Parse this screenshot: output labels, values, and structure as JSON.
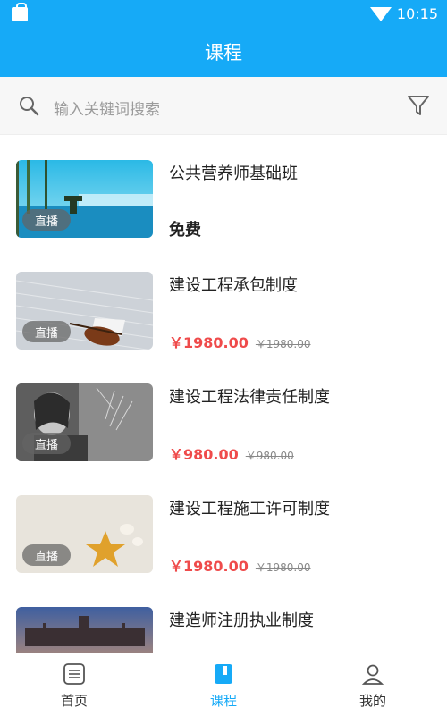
{
  "status_bar": {
    "time": "10:15"
  },
  "header": {
    "title": "课程"
  },
  "search": {
    "placeholder": "输入关键词搜索"
  },
  "courses": [
    {
      "title": "公共营养师基础班",
      "badge": "直播",
      "price": "免费"
    },
    {
      "title": "建设工程承包制度",
      "badge": "直播",
      "price": "￥1980.00",
      "original_price": "￥1980.00"
    },
    {
      "title": "建设工程法律责任制度",
      "badge": "直播",
      "price": "￥980.00",
      "original_price": "￥980.00"
    },
    {
      "title": "建设工程施工许可制度",
      "badge": "直播",
      "price": "￥1980.00",
      "original_price": "￥1980.00"
    },
    {
      "title": "建造师注册执业制度"
    }
  ],
  "bottom_nav": {
    "items": [
      {
        "label": "首页"
      },
      {
        "label": "课程"
      },
      {
        "label": "我的"
      }
    ],
    "active_color": "#16aaf7"
  },
  "colors": {
    "brand": "#16aaf7",
    "price": "#ef4b4b"
  }
}
